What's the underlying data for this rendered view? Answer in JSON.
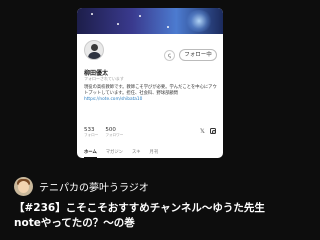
{
  "profile": {
    "tip_icon": "note-tip-icon",
    "follow_label": "フォロー中",
    "name": "柳田優太",
    "follows_you": "フォローされています",
    "bio": "現役の高校教師です。教師こそ学びが必要。学んだことを中心にアウトプットしています。担任、社会科、野球部顧問",
    "bio_link": "https://note.com/shibata10",
    "stats": [
      {
        "value": "533",
        "label": "フォロー"
      },
      {
        "value": "500",
        "label": "フォロワー"
      }
    ],
    "social_icons": [
      "x-icon",
      "instagram-icon"
    ],
    "tabs": [
      "ホーム",
      "マガジン",
      "スキ",
      "月刊"
    ],
    "active_tab": "ホーム"
  },
  "episode": {
    "channel_name": "テニパカの夢叶うラジオ",
    "title": "【#236】こそこそおすすめチャンネル〜ゆうた先生noteやってたの？〜の巻"
  },
  "colors": {
    "background": "#0d0d0d",
    "card": "#ffffff",
    "link": "#2a7ec2"
  }
}
